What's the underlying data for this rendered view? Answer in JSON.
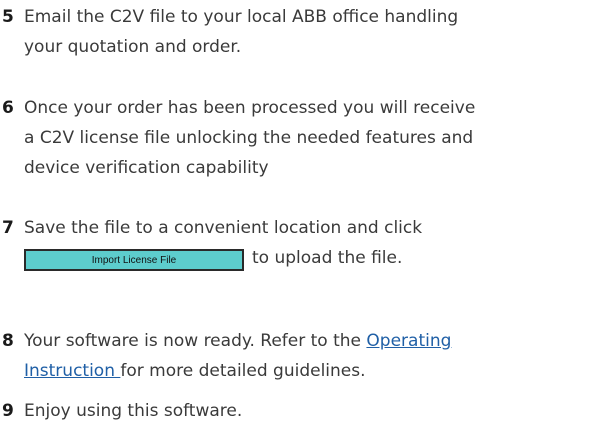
{
  "steps": [
    {
      "number": "5",
      "lines": [
        "Email the C2V file to your local ABB office handling",
        "your quotation and order."
      ]
    },
    {
      "number": "6",
      "lines": [
        "Once your order has been processed you will receive",
        "a C2V license file unlocking the needed features and",
        "device verification capability"
      ]
    },
    {
      "number": "7",
      "line1": "Save the file to a convenient location and click",
      "button_label": "Import License File",
      "after_button": "to upload the file."
    },
    {
      "number": "8",
      "line1_before": "Your software is now ready. Refer to the ",
      "link_part1": "Operating",
      "link_part2": "Instruction ",
      "line2_after": "for more detailed guidelines.",
      "link_color": "#1f5fa6"
    },
    {
      "number": "9",
      "lines": [
        "Enjoy using this software."
      ]
    }
  ],
  "colors": {
    "text": "#3a3a3a",
    "number": "#1a1a1a",
    "button_fill": "#5dcdcd",
    "button_border": "#2a2a2a"
  }
}
